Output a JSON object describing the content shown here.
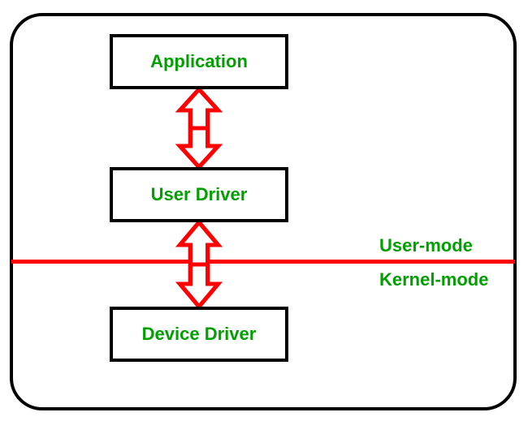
{
  "nodes": {
    "application": {
      "label": "Application"
    },
    "user_driver": {
      "label": "User Driver"
    },
    "device_driver": {
      "label": "Device Driver"
    }
  },
  "connectors": {
    "app_to_user": {
      "kind": "bidirectional"
    },
    "user_to_device": {
      "kind": "bidirectional"
    }
  },
  "mode_boundary": {
    "upper_label": "User-mode",
    "lower_label": "Kernel-mode"
  },
  "style": {
    "accent_red": "#ff0000",
    "accent_green": "#00a000",
    "border_black": "#000000"
  },
  "chart_data": {
    "type": "diagram",
    "title": "",
    "nodes": [
      {
        "id": "application",
        "label": "Application",
        "layer": "user-mode"
      },
      {
        "id": "user_driver",
        "label": "User Driver",
        "layer": "user-mode"
      },
      {
        "id": "device_driver",
        "label": "Device Driver",
        "layer": "kernel-mode"
      }
    ],
    "edges": [
      {
        "from": "application",
        "to": "user_driver",
        "direction": "bidirectional"
      },
      {
        "from": "user_driver",
        "to": "device_driver",
        "direction": "bidirectional"
      }
    ],
    "boundaries": [
      {
        "between": [
          "user_driver",
          "device_driver"
        ],
        "upper": "User-mode",
        "lower": "Kernel-mode"
      }
    ]
  }
}
